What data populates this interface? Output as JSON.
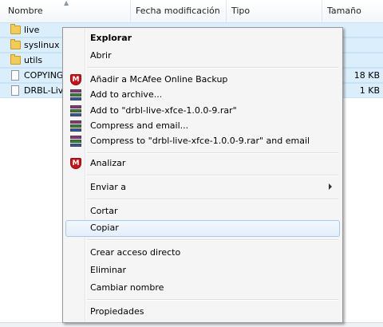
{
  "columns": {
    "name": "Nombre",
    "date": "Fecha modificación",
    "type": "Tipo",
    "size": "Tamaño"
  },
  "files": [
    {
      "name": "live",
      "kind": "folder",
      "size": ""
    },
    {
      "name": "syslinux",
      "kind": "folder",
      "size": ""
    },
    {
      "name": "utils",
      "kind": "folder",
      "size": ""
    },
    {
      "name": "COPYING",
      "kind": "file",
      "size": "18 KB"
    },
    {
      "name": "DRBL-Live",
      "kind": "file",
      "size": "1 KB"
    }
  ],
  "context_menu": {
    "explore": "Explorar",
    "open": "Abrir",
    "mcafee_backup": "Añadir a McAfee Online Backup",
    "add_archive": "Add to archive...",
    "add_rar": "Add to \"drbl-live-xfce-1.0.0-9.rar\"",
    "compress_email": "Compress and email...",
    "compress_rar_email": "Compress to \"drbl-live-xfce-1.0.0-9.rar\" and email",
    "analyze": "Analizar",
    "send_to": "Enviar a",
    "cut": "Cortar",
    "copy": "Copiar",
    "create_shortcut": "Crear acceso directo",
    "delete": "Eliminar",
    "rename": "Cambiar nombre",
    "properties": "Propiedades"
  },
  "icons": {
    "mcafee": "mcafee-icon",
    "rar": "winrar-icon",
    "folder": "folder-icon",
    "file": "file-icon"
  },
  "colors": {
    "selection": "#dbeefc",
    "menu_bg": "#f5f5f5",
    "menu_hover_border": "#a8c8ec",
    "mcafee_red": "#c8141b"
  }
}
